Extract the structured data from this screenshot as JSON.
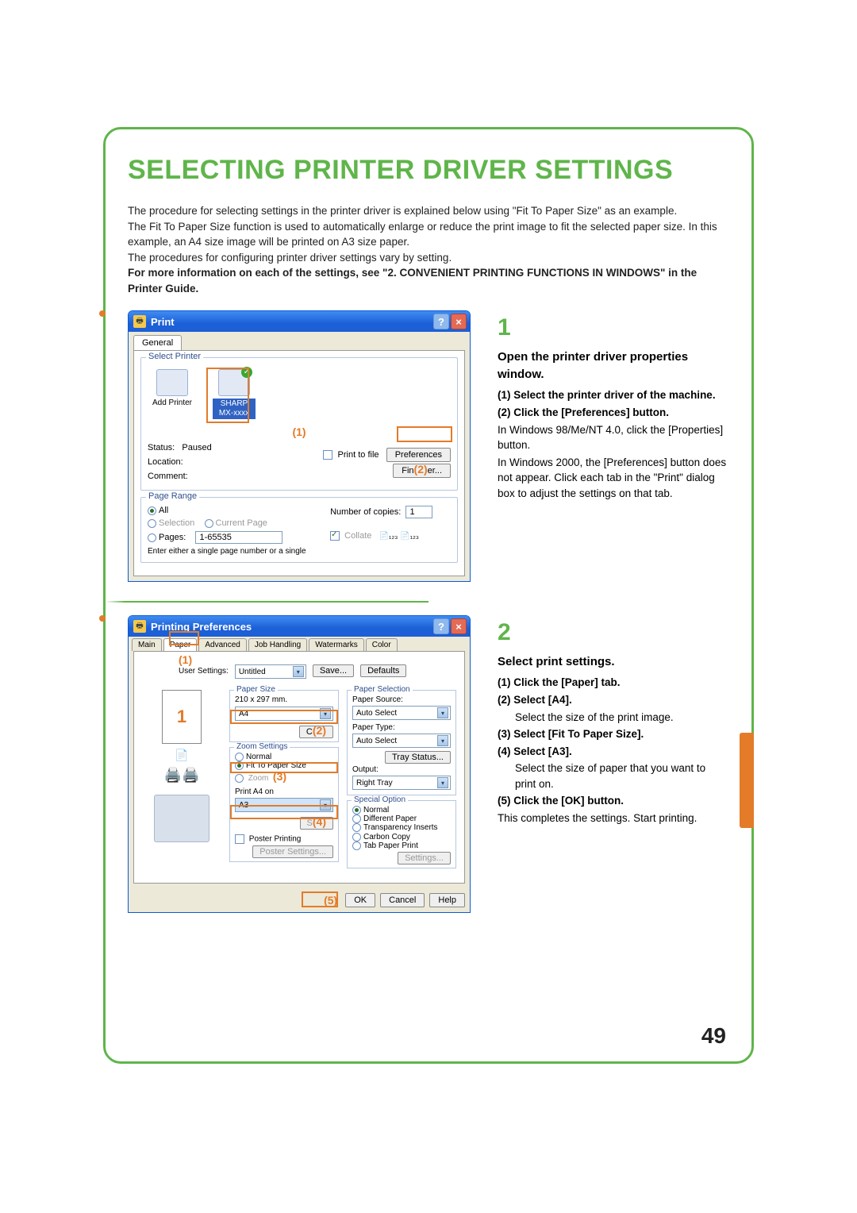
{
  "page": {
    "title": "SELECTING PRINTER DRIVER SETTINGS",
    "intro_p1a": "The procedure for selecting settings in the printer driver is explained below using \"Fit To Paper Size\" as an example.",
    "intro_p2": "The Fit To Paper Size function is used to automatically enlarge or reduce the print image to fit the selected paper size. In this example, an A4 size image will be printed on A3 size paper.",
    "intro_p3": "The procedures for configuring printer driver settings vary by setting.",
    "intro_bold": "For more information on each of the settings, see \"2. CONVENIENT PRINTING FUNCTIONS IN WINDOWS\" in the Printer Guide.",
    "page_number": "49"
  },
  "step1": {
    "num": "1",
    "heading": "Open the printer driver properties window.",
    "sub1": "(1) Select the printer driver of the machine.",
    "sub2": "(2) Click the [Preferences] button.",
    "body1": "In Windows 98/Me/NT 4.0, click the [Properties] button.",
    "body2": "In Windows 2000, the [Preferences] button does not appear. Click each tab in the \"Print\" dialog box to adjust the settings on that tab."
  },
  "step2": {
    "num": "2",
    "heading": "Select print settings.",
    "sub1": "(1) Click the [Paper] tab.",
    "sub2": "(2) Select [A4].",
    "body2": "Select the size of the print image.",
    "sub3": "(3) Select [Fit To Paper Size].",
    "sub4": "(4) Select [A3].",
    "body4": "Select the size of paper that you want to print on.",
    "sub5": "(5) Click the [OK] button.",
    "body5": "This completes the settings. Start printing."
  },
  "print_dialog": {
    "title": "Print",
    "tab_general": "General",
    "group_select_printer": "Select Printer",
    "add_printer_label": "Add Printer",
    "selected_printer_line1": "SHARP",
    "selected_printer_line2": "MX-xxxx",
    "status_label": "Status:",
    "status_value": "Paused",
    "location_label": "Location:",
    "comment_label": "Comment:",
    "print_to_file_label": "Print to file",
    "preferences_btn": "Preferences",
    "find_printer_btn": "Find Printer...",
    "group_page_range": "Page Range",
    "opt_all": "All",
    "opt_selection": "Selection",
    "opt_current": "Current Page",
    "opt_pages": "Pages:",
    "pages_value": "1-65535",
    "pages_hint": "Enter either a single page number or a single",
    "copies_label": "Number of copies:",
    "copies_value": "1",
    "collate_label": "Collate",
    "callout1": "(1)",
    "callout2": "(2)"
  },
  "pref_dialog": {
    "title": "Printing Preferences",
    "tabs": {
      "main": "Main",
      "paper": "Paper",
      "advanced": "Advanced",
      "job": "Job Handling",
      "watermarks": "Watermarks",
      "color": "Color"
    },
    "user_settings_label": "User Settings:",
    "user_settings_value": "Untitled",
    "save_btn": "Save...",
    "defaults_btn": "Defaults",
    "paper_size_group": "Paper Size",
    "paper_size_dim": "210 x 297 mm.",
    "paper_size_value": "A4",
    "custom_btn": "Custom...",
    "zoom_group": "Zoom Settings",
    "zoom_normal": "Normal",
    "zoom_fit": "Fit To Paper Size",
    "zoom_zoom": "Zoom",
    "print_a4_on": "Print A4 on",
    "fit_value": "A3",
    "settings_btn": "Settings",
    "poster_printing": "Poster Printing",
    "poster_settings_btn": "Poster Settings...",
    "paper_selection_group": "Paper Selection",
    "paper_source_label": "Paper Source:",
    "paper_source_value": "Auto Select",
    "paper_type_label": "Paper Type:",
    "paper_type_value": "Auto Select",
    "tray_status_btn": "Tray Status...",
    "output_label": "Output:",
    "output_value": "Right Tray",
    "special_group": "Special Option",
    "so_normal": "Normal",
    "so_diff_paper": "Different Paper",
    "so_trans": "Transparency Inserts",
    "so_carbon": "Carbon Copy",
    "so_tab": "Tab Paper Print",
    "so_settings_btn": "Settings...",
    "ok_btn": "OK",
    "cancel_btn": "Cancel",
    "help_btn": "Help",
    "callout1": "(1)",
    "callout2": "(2)",
    "callout3": "(3)",
    "callout4": "(4)",
    "callout5": "(5)",
    "preview_one": "1"
  }
}
